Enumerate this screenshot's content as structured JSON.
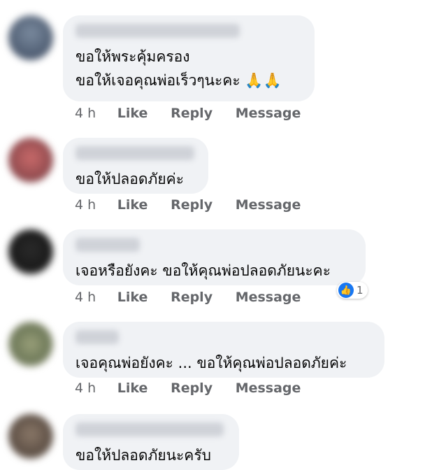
{
  "comments": [
    {
      "lines": [
        "ขอให้พระคุ้มครอง",
        "ขอให้เจอคุณพ่อเร็วๆนะคะ 🙏🙏"
      ],
      "time": "4 h"
    },
    {
      "lines": [
        "ขอให้ปลอดภัยค่ะ"
      ],
      "time": "4 h"
    },
    {
      "lines": [
        "เจอหรือยังคะ ขอให้คุณพ่อปลอดภัยนะคะ"
      ],
      "time": "4 h",
      "reaction_count": "1"
    },
    {
      "lines": [
        "เจอคุณพ่อยังคะ ... ขอให้คุณพ่อปลอดภัยค่ะ"
      ],
      "time": "4 h"
    },
    {
      "lines": [
        "ขอให้ปลอดภัยนะครับ"
      ]
    }
  ],
  "actions": {
    "like": "Like",
    "reply": "Reply",
    "message": "Message"
  },
  "colors": {
    "bubble": "#f0f2f5",
    "meta": "#65676b",
    "like_blue": "#1877f2"
  }
}
